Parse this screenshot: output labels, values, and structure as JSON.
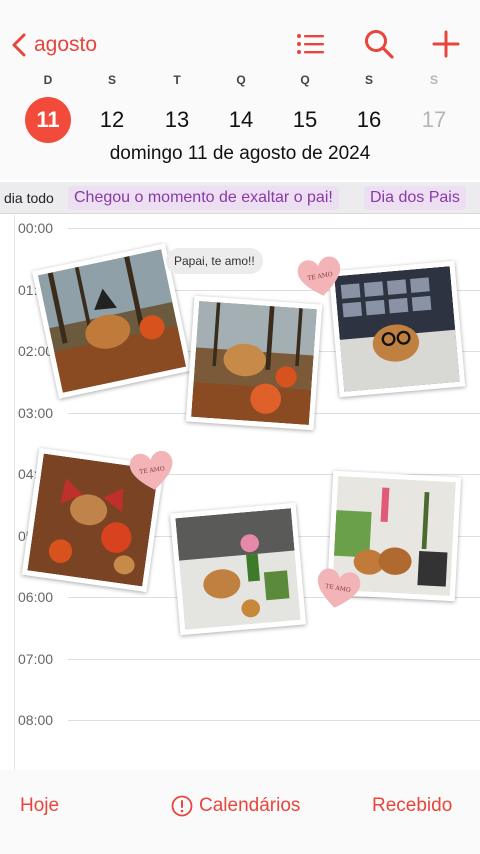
{
  "header": {
    "back_label": "agosto",
    "icons": [
      "chevron-left-icon",
      "list-icon",
      "search-icon",
      "plus-icon"
    ],
    "accent": "#e8453c"
  },
  "week": {
    "days": [
      {
        "letter": "D",
        "num": "11",
        "selected": true
      },
      {
        "letter": "S",
        "num": "12"
      },
      {
        "letter": "T",
        "num": "13"
      },
      {
        "letter": "Q",
        "num": "14"
      },
      {
        "letter": "Q",
        "num": "15"
      },
      {
        "letter": "S",
        "num": "16"
      },
      {
        "letter": "S",
        "num": "17",
        "dim": true
      }
    ],
    "full_date": "domingo  11 de agosto de 2024"
  },
  "all_day": {
    "label": "dia todo",
    "events": [
      "Chegou o momento de exaltar o pai!",
      "Dia dos Pais"
    ],
    "event_color": "#8a3aa7"
  },
  "hours": [
    "00:00",
    "01:00",
    "02:00",
    "03:00",
    "04:00",
    "05:00",
    "06:00",
    "07:00",
    "08:00"
  ],
  "stickers": {
    "bubble": "Papai, te amo!!",
    "heart_text": "TE AMO"
  },
  "bottom": {
    "today": "Hoje",
    "calendars": "Calendários",
    "inbox": "Recebido"
  }
}
